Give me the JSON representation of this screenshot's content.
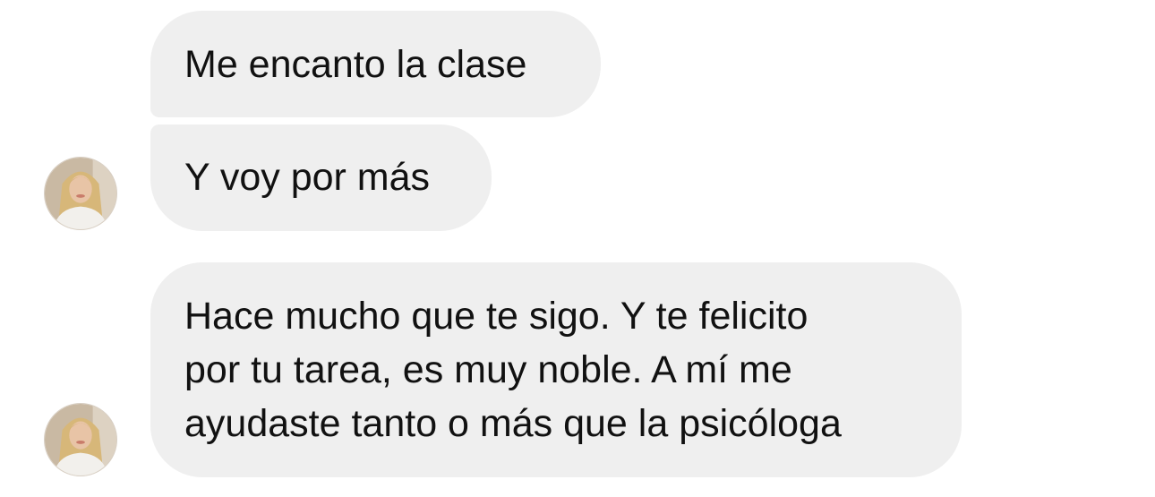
{
  "messages": [
    {
      "lines": [
        "Me encanto la clase"
      ]
    },
    {
      "lines": [
        "Y voy por más"
      ]
    },
    {
      "lines": [
        "Hace mucho que te sigo. Y te felicito",
        "por tu tarea, es muy noble. A mí me",
        "ayudaste tanto o más que la psicóloga"
      ]
    }
  ],
  "colors": {
    "bubble_background": "#efefef",
    "text": "#111111",
    "page_background": "#ffffff"
  }
}
